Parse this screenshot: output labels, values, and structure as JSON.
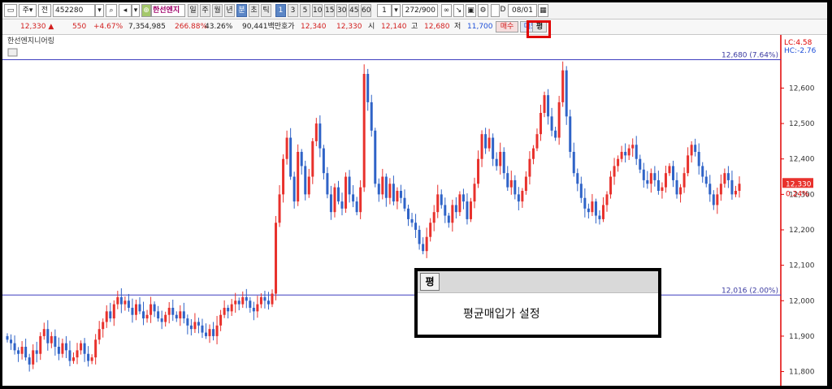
{
  "toolbar": {
    "market_label": "주",
    "all_label": "전",
    "code_value": "452280",
    "stock_name": "한선엔지니",
    "periods": [
      "일",
      "주",
      "월",
      "년",
      "분",
      "초",
      "틱"
    ],
    "minute_options": [
      "1",
      "3",
      "5",
      "10",
      "15",
      "30",
      "45",
      "60"
    ],
    "unit_value": "1",
    "count_value": "272",
    "count_total": "/900",
    "checkbox_label": "D",
    "date_value": "08/01"
  },
  "quote": {
    "price": "12,330 ▲",
    "change": "550",
    "change_pct": "+4.67%",
    "volume": "7,354,985",
    "volume_ratio": "266.88%",
    "turnover": "43.26%",
    "amount": "90,441백만",
    "bid_label": "호가",
    "bid1": "12,340",
    "bid2": "12,330",
    "open_label": "시",
    "open": "12,140",
    "high_label": "고",
    "high": "12,680",
    "low_label": "저",
    "low": "11,700",
    "buy_label": "매수",
    "sell_label": "매도",
    "avg_label": "평"
  },
  "chart_title": "한선엔지니어링",
  "colors": {
    "up": "#e8312c",
    "down": "#2f63c7",
    "axis_line": "#e00000",
    "ref_line": "#3f3fbf",
    "highlight": "#e00000"
  },
  "chart_data": {
    "type": "candlestick",
    "y_ticks": [
      "12,600",
      "12,500",
      "12,400",
      "12,300",
      "12,200",
      "12,100",
      "12,000",
      "11,900",
      "11,800"
    ],
    "ylim": [
      11760,
      12750
    ],
    "current_price_label": "12,330",
    "current_change_label": "0.24%",
    "lc_label": "LC:4.58",
    "hc_label": "HC:-2.76",
    "reference_lines": [
      {
        "value": 12680,
        "label": "12,680 (7.64%)"
      },
      {
        "value": 12016,
        "label": "12,016 (2.00%)"
      }
    ],
    "closes": [
      11890,
      11880,
      11860,
      11850,
      11870,
      11840,
      11820,
      11860,
      11850,
      11900,
      11920,
      11880,
      11900,
      11870,
      11850,
      11880,
      11860,
      11830,
      11840,
      11860,
      11880,
      11850,
      11830,
      11840,
      11890,
      11920,
      11940,
      11970,
      11950,
      11990,
      12010,
      11990,
      12000,
      11980,
      11960,
      11990,
      11970,
      11950,
      11960,
      11990,
      11970,
      11950,
      11940,
      11960,
      11980,
      11960,
      11950,
      11970,
      11950,
      11930,
      11920,
      11940,
      11930,
      11910,
      11900,
      11920,
      11900,
      11930,
      11960,
      11980,
      11970,
      11990,
      12000,
      11990,
      12010,
      12000,
      11980,
      11970,
      11990,
      12010,
      12000,
      11990,
      12020,
      12220,
      12300,
      12400,
      12460,
      12350,
      12280,
      12420,
      12380,
      12300,
      12350,
      12450,
      12500,
      12430,
      12360,
      12300,
      12250,
      12320,
      12280,
      12260,
      12350,
      12300,
      12280,
      12250,
      12320,
      12640,
      12560,
      12480,
      12330,
      12300,
      12350,
      12290,
      12330,
      12280,
      12310,
      12290,
      12260,
      12230,
      12220,
      12200,
      12160,
      12140,
      12180,
      12220,
      12250,
      12300,
      12270,
      12240,
      12220,
      12270,
      12250,
      12300,
      12280,
      12230,
      12280,
      12330,
      12400,
      12470,
      12430,
      12460,
      12400,
      12380,
      12420,
      12360,
      12320,
      12340,
      12300,
      12280,
      12310,
      12350,
      12400,
      12430,
      12470,
      12530,
      12580,
      12520,
      12480,
      12460,
      12560,
      12650,
      12520,
      12420,
      12360,
      12330,
      12290,
      12260,
      12250,
      12280,
      12240,
      12230,
      12270,
      12300,
      12350,
      12380,
      12400,
      12420,
      12410,
      12430,
      12440,
      12400,
      12370,
      12340,
      12330,
      12360,
      12340,
      12310,
      12320,
      12360,
      12380,
      12340,
      12300,
      12320,
      12360,
      12410,
      12440,
      12420,
      12380,
      12350,
      12330,
      12300,
      12270,
      12300,
      12330,
      12360,
      12340,
      12300,
      12310,
      12330
    ]
  },
  "popup": {
    "icon_label": "평",
    "menu_item": "평균매입가 설정"
  }
}
